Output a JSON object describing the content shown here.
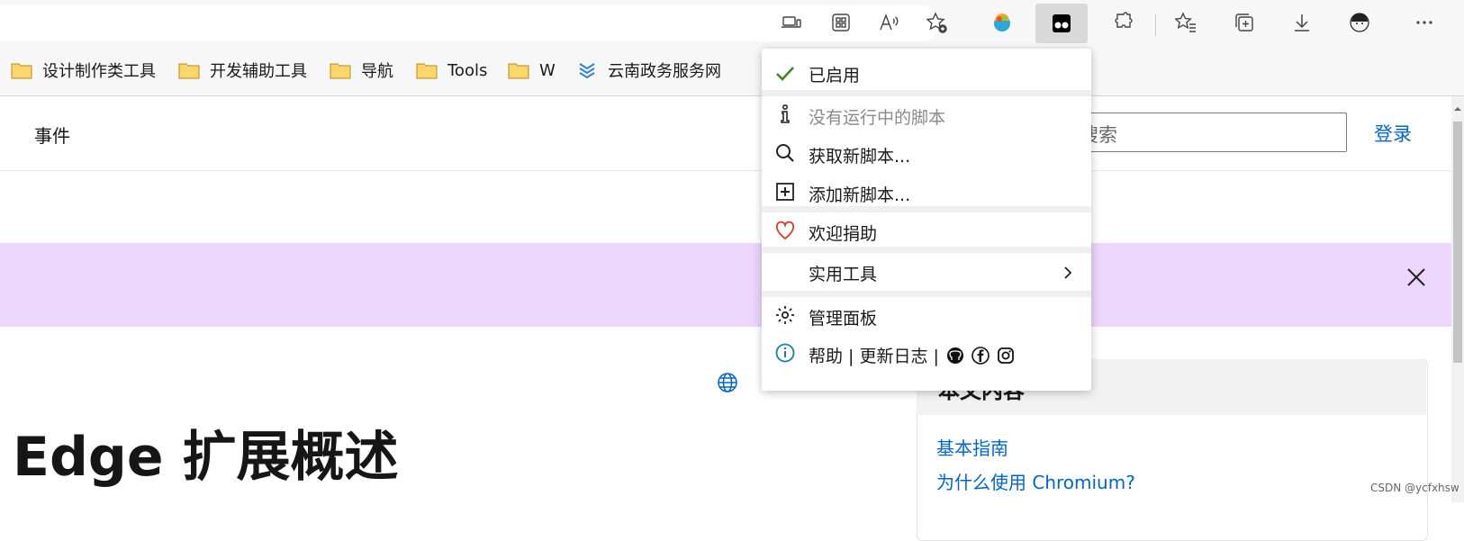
{
  "bookmarks": [
    {
      "label": "设计制作类工具",
      "icon": "folder-icon"
    },
    {
      "label": "开发辅助工具",
      "icon": "folder-icon"
    },
    {
      "label": "导航",
      "icon": "folder-icon"
    },
    {
      "label": "Tools",
      "icon": "folder-icon"
    },
    {
      "label": "W",
      "icon": "folder-icon"
    },
    {
      "label": "云南政务服务网",
      "icon": "site-logo-icon"
    }
  ],
  "page": {
    "nav_events": "事件",
    "search_placeholder": "搜索",
    "login": "登录",
    "title": "Edge 扩展概述",
    "toc_title": "本文内容",
    "toc_links": [
      "基本指南",
      "为什么使用 Chromium?"
    ]
  },
  "menu": {
    "enabled": "已启用",
    "no_scripts": "没有运行中的脚本",
    "get_new": "获取新脚本...",
    "add_new": "添加新脚本...",
    "donate": "欢迎捐助",
    "tools": "实用工具",
    "dashboard": "管理面板",
    "help": "帮助 | 更新日志 |"
  },
  "watermark": "CSDN @ycfxhsw",
  "colors": {
    "accent": "#0066cc",
    "banner": "#ecd6fb",
    "check": "#3d8b1e",
    "heart": "#d83b2b"
  }
}
